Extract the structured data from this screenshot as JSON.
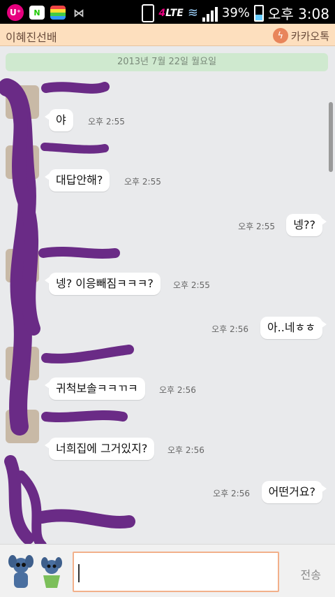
{
  "status_bar": {
    "carrier_icon_label": "U⁺",
    "naver_icon_label": "N",
    "network_type": "LTE",
    "battery_percent": "39%",
    "battery_level": 0.39,
    "time": "오후 3:08",
    "icons": [
      "uplus-icon",
      "naver-icon",
      "app-stack-icon",
      "bowtie-icon",
      "phone-icon",
      "lte-icon",
      "wifi-icon",
      "signal-icon",
      "battery-icon"
    ]
  },
  "header": {
    "title": "이혜진선배",
    "brand": "카카오톡"
  },
  "chat": {
    "date_divider": "2013년 7월 22일 월요일",
    "messages": [
      {
        "side": "left",
        "text": "야",
        "time": "오후 2:55"
      },
      {
        "side": "left",
        "text": "대답안해?",
        "time": "오후 2:55"
      },
      {
        "side": "right",
        "text": "넹??",
        "time": "오후 2:55"
      },
      {
        "side": "left",
        "text": "넹? 이응빼짐ㅋㅋㅋ?",
        "time": "오후 2:55"
      },
      {
        "side": "right",
        "text": "아..네ㅎㅎ",
        "time": "오후 2:56"
      },
      {
        "side": "left",
        "text": "귀척보솔ㅋㅋㄲㅋ",
        "time": "오후 2:56"
      },
      {
        "side": "left",
        "text": "너희집에 그거있지?",
        "time": "오후 2:56"
      },
      {
        "side": "right",
        "text": "어떤거요?",
        "time": "오후 2:56"
      }
    ]
  },
  "composer": {
    "input_value": "",
    "send_label": "전송"
  },
  "colors": {
    "title_bar": "#fddfbe",
    "date_bar": "#cfe9cf",
    "chat_bg": "#e9eaec",
    "redaction": "#6a2b86",
    "input_border": "#f2b08a"
  }
}
